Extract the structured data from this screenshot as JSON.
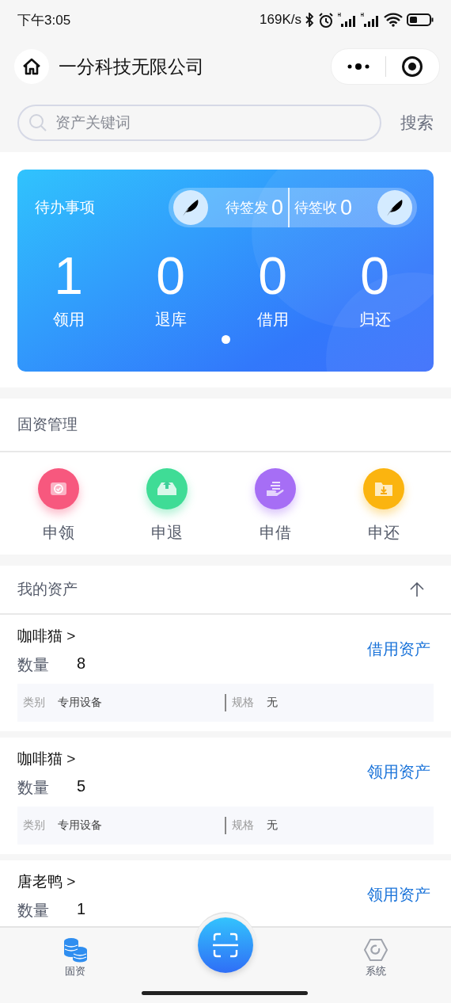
{
  "status_bar": {
    "time": "下午3:05",
    "net_speed": "169K/s"
  },
  "nav": {
    "title": "一分科技无限公司"
  },
  "search": {
    "placeholder": "资产关键词",
    "button": "搜索"
  },
  "todo_card": {
    "title": "待办事项",
    "sign_items": [
      {
        "label": "待签发",
        "count": "0"
      },
      {
        "label": "待签收",
        "count": "0"
      }
    ],
    "stats": [
      {
        "value": "1",
        "label": "领用"
      },
      {
        "value": "0",
        "label": "退库"
      },
      {
        "value": "0",
        "label": "借用"
      },
      {
        "value": "0",
        "label": "归还"
      }
    ],
    "pager": [
      {
        "selected": true
      }
    ]
  },
  "fixed_assets": {
    "title": "固资管理",
    "actions": [
      {
        "label": "申领",
        "color": "#f7587e"
      },
      {
        "label": "申退",
        "color": "#3fdc96"
      },
      {
        "label": "申借",
        "color": "#a66ef5"
      },
      {
        "label": "申还",
        "color": "#fbb40f"
      }
    ]
  },
  "my_assets": {
    "title": "我的资产",
    "expanded": true,
    "items": [
      {
        "name": "咖啡猫 >",
        "action": "借用资产",
        "quantity_label": "数量",
        "quantity": "8",
        "category_label": "类别",
        "category": "专用设备",
        "spec_label": "规格",
        "spec": "无"
      },
      {
        "name": "咖啡猫 >",
        "action": "领用资产",
        "quantity_label": "数量",
        "quantity": "5",
        "category_label": "类别",
        "category": "专用设备",
        "spec_label": "规格",
        "spec": "无"
      },
      {
        "name": "唐老鸭 >",
        "action": "领用资产",
        "quantity_label": "数量",
        "quantity": "1"
      }
    ]
  },
  "tab_bar": {
    "tabs": [
      {
        "label": "固资",
        "selected": true
      },
      {
        "label": "系统",
        "selected": false
      }
    ]
  }
}
